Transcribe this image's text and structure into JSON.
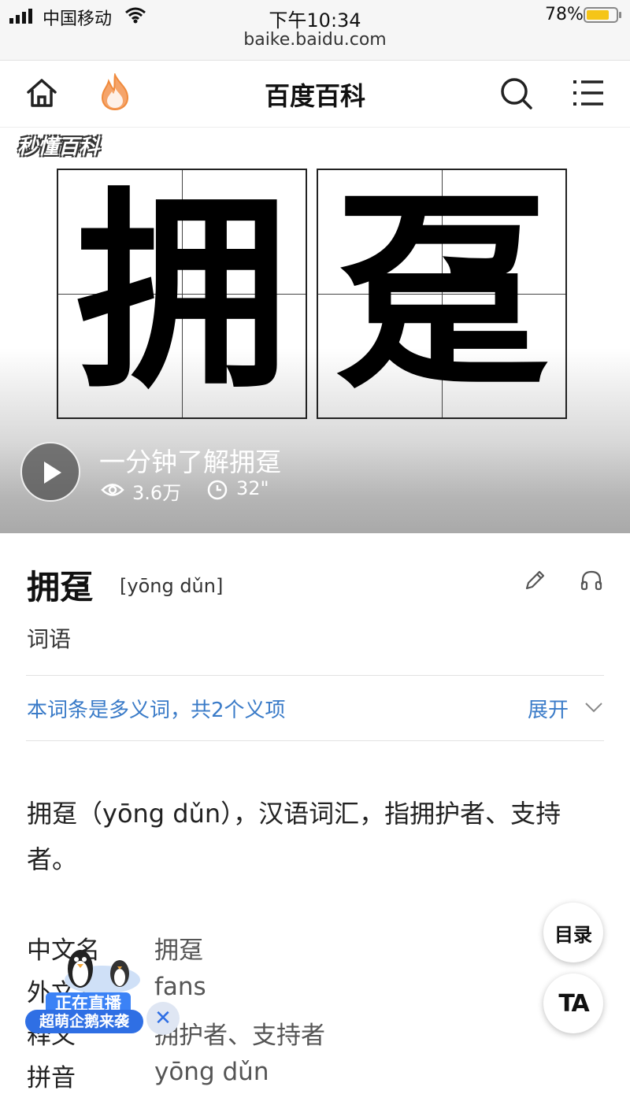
{
  "status_bar": {
    "carrier": "中国移动",
    "time": "下午10:34",
    "url": "baike.baidu.com",
    "battery_percent": "78%",
    "battery_level": 0.78,
    "battery_color": "#f5c518"
  },
  "nav": {
    "title": "百度百科",
    "icons": [
      "home-icon",
      "flame-icon",
      "search-icon",
      "menu-icon"
    ]
  },
  "hero": {
    "brand": "秒懂百科",
    "characters": [
      "拥",
      "趸"
    ],
    "video_title": "一分钟了解拥趸",
    "views": "3.6万",
    "duration": "32\""
  },
  "entry": {
    "word": "拥趸",
    "pinyin": "[yōng dǔn]",
    "category": "词语",
    "polysemy_note": "本词条是多义词，共2个义项",
    "expand_label": "展开",
    "summary": "拥趸（yōng dǔn），汉语词汇，指拥护者、支持者。"
  },
  "basic_info": [
    {
      "key": "中文名",
      "value": "拥趸"
    },
    {
      "key": "外文名",
      "value": "fans"
    },
    {
      "key": "释义",
      "value": "拥护者、支持者"
    },
    {
      "key": "拼音",
      "value": "yōng dǔn"
    }
  ],
  "floating": {
    "toc_label": "目录",
    "ta_label": "TA"
  },
  "live_promo": {
    "banner": "正在直播",
    "subtitle": "超萌企鹅来袭",
    "close_label": "✕"
  },
  "colors": {
    "link_blue": "#3a7bc8",
    "flame_orange": "#f08a3c"
  }
}
